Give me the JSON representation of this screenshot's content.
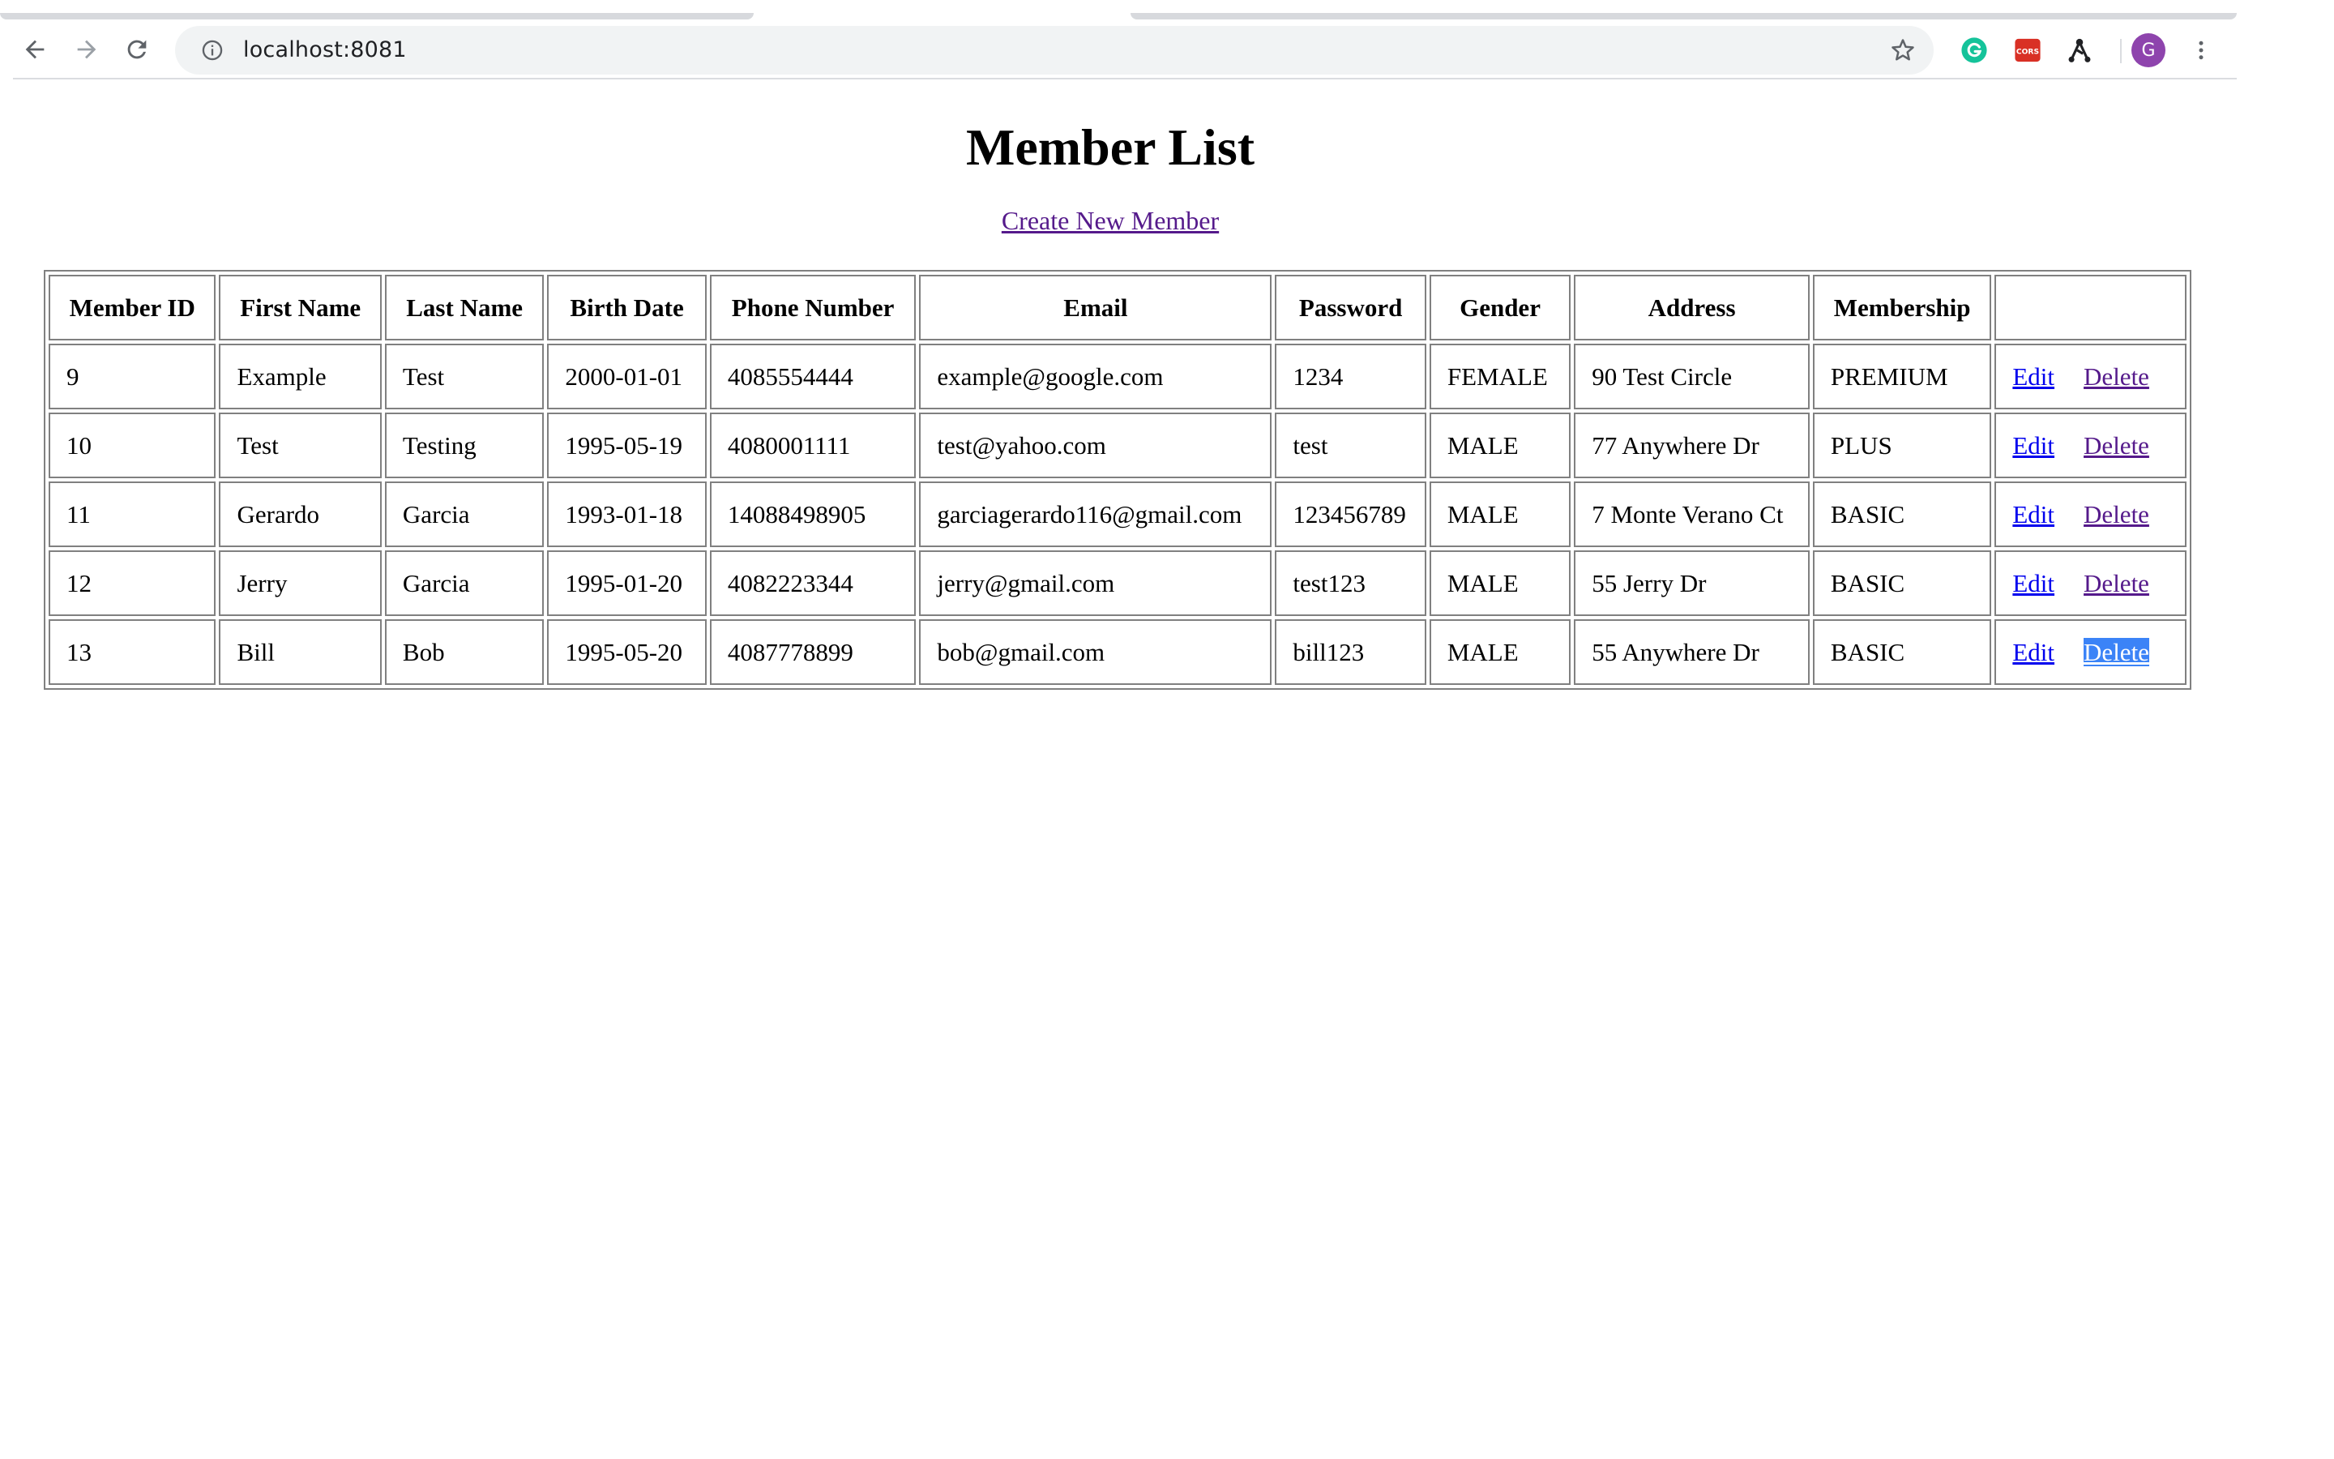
{
  "browser": {
    "url": "localhost:8081",
    "profile_initial": "G",
    "extensions": [
      "grammarly-icon",
      "cors-icon",
      "graph-icon"
    ],
    "cors_label": "CORS"
  },
  "page": {
    "title": "Member List",
    "create_link": "Create New Member"
  },
  "table": {
    "headers": [
      "Member ID",
      "First Name",
      "Last Name",
      "Birth Date",
      "Phone Number",
      "Email",
      "Password",
      "Gender",
      "Address",
      "Membership",
      ""
    ],
    "rows": [
      [
        "9",
        "Example",
        "Test",
        "2000-01-01",
        "4085554444",
        "example@google.com",
        "1234",
        "FEMALE",
        "90 Test Circle",
        "PREMIUM"
      ],
      [
        "10",
        "Test",
        "Testing",
        "1995-05-19",
        "4080001111",
        "test@yahoo.com",
        "test",
        "MALE",
        "77 Anywhere Dr",
        "PLUS"
      ],
      [
        "11",
        "Gerardo",
        "Garcia",
        "1993-01-18",
        "14088498905",
        "garciagerardo116@gmail.com",
        "123456789",
        "MALE",
        "7 Monte Verano Ct",
        "BASIC"
      ],
      [
        "12",
        "Jerry",
        "Garcia",
        "1995-01-20",
        "4082223344",
        "jerry@gmail.com",
        "test123",
        "MALE",
        "55 Jerry Dr",
        "BASIC"
      ],
      [
        "13",
        "Bill",
        "Bob",
        "1995-05-20",
        "4087778899",
        "bob@gmail.com",
        "bill123",
        "MALE",
        "55 Anywhere Dr",
        "BASIC"
      ]
    ],
    "edit_label": "Edit",
    "delete_label": "Delete",
    "selected_delete_row": 4
  },
  "colors": {
    "link": "#0000ee",
    "visited_link": "#551a8b",
    "selection": "#3b83f7",
    "profile_avatar": "#8e44ad"
  }
}
